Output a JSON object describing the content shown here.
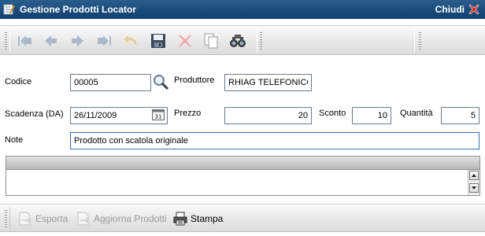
{
  "window": {
    "title": "Gestione Prodotti Locator",
    "close_label": "Chiudi"
  },
  "toolbar": {
    "icons": [
      "first-record-icon",
      "previous-record-icon",
      "next-record-icon",
      "last-record-icon",
      "undo-icon",
      "save-icon",
      "delete-icon",
      "copy-icon",
      "search-binoculars-icon"
    ]
  },
  "form": {
    "codice_label": "Codice",
    "codice_value": "00005",
    "produttore_label": "Produttore",
    "produttore_value": "RHIAG TELEFONICO",
    "scadenza_label": "Scadenza (DA)",
    "scadenza_value": "26/11/2009",
    "prezzo_label": "Prezzo",
    "prezzo_value": "20",
    "sconto_label": "Sconto",
    "sconto_value": "10",
    "quantita_label": "Quantità",
    "quantita_value": "5",
    "note_label": "Note",
    "note_value": "Prodotto con scatola originale",
    "calendar_icon_text": "31"
  },
  "bottom": {
    "esporta_label": "Esporta",
    "aggiorna_label": "Aggiorna Prodotti",
    "stampa_label": "Stampa"
  },
  "colors": {
    "titlebar": "#1f4f7e",
    "close": "#d92b1f",
    "nav_disabled": "#a9b8cc",
    "delete_disabled": "#f2a6a6"
  }
}
